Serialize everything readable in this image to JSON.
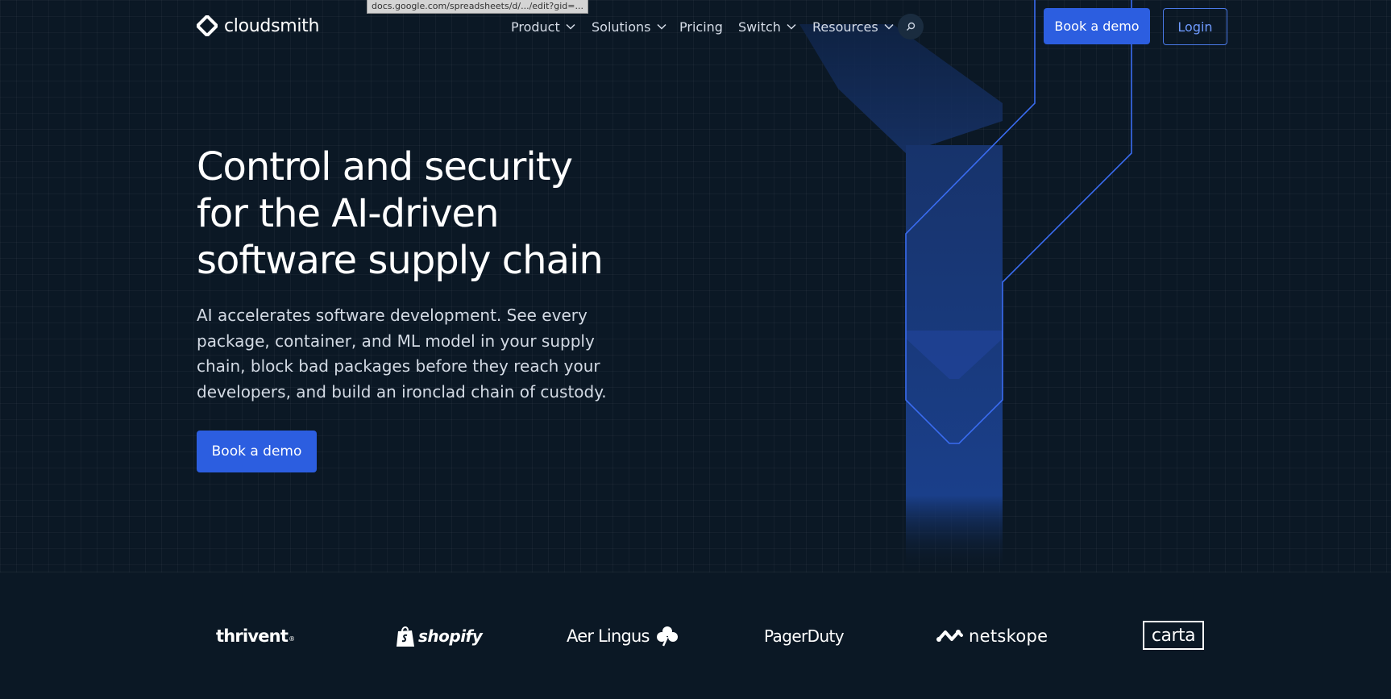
{
  "brand": {
    "name": "cloudsmith",
    "logo_icon": "cloudsmith-diamond-icon"
  },
  "browser": {
    "status_url": "docs.google.com/spreadsheets/d/.../edit?gid=..."
  },
  "nav": {
    "items": [
      {
        "label": "Product",
        "has_dropdown": true
      },
      {
        "label": "Solutions",
        "has_dropdown": true
      },
      {
        "label": "Pricing",
        "has_dropdown": false
      },
      {
        "label": "Switch",
        "has_dropdown": true
      },
      {
        "label": "Resources",
        "has_dropdown": true
      }
    ],
    "search_icon": "search-icon",
    "cta_label": "Book a demo",
    "login_label": "Login"
  },
  "hero": {
    "title_lines": [
      "Control and security",
      "for the AI-driven",
      "software supply chain"
    ],
    "subtitle_lines": [
      "AI accelerates software development. See every",
      "package, container, and ML model in your supply",
      "chain, block bad packages before they reach your",
      "developers, and build an ironclad chain of custody."
    ],
    "cta_label": "Book a demo"
  },
  "customers": [
    {
      "name": "thrivent",
      "text": "thrivent",
      "mark": "registered"
    },
    {
      "name": "shopify",
      "text": "shopify",
      "icon": "shopping-bag-icon"
    },
    {
      "name": "aer-lingus",
      "text": "Aer Lingus",
      "icon": "shamrock-icon"
    },
    {
      "name": "pagerduty",
      "text": "PagerDuty"
    },
    {
      "name": "netskope",
      "text": "netskope",
      "icon": "netskope-wave-icon"
    },
    {
      "name": "carta",
      "text": "carta"
    }
  ],
  "colors": {
    "background": "#0b1825",
    "accent": "#2c5ee0",
    "accent_outline": "#4a79e8",
    "text_primary": "#ffffff",
    "text_secondary": "#d3dae4"
  }
}
